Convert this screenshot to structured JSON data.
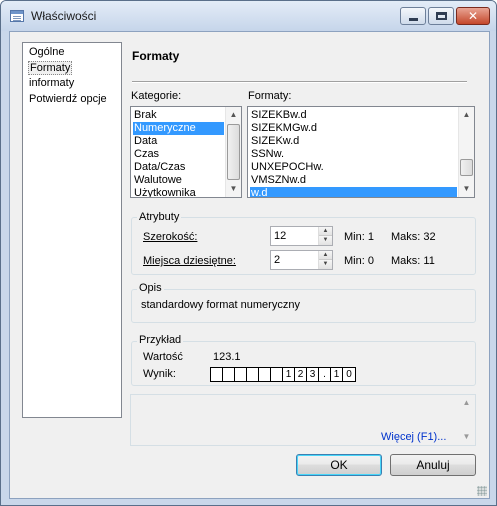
{
  "window": {
    "title": "Właściwości",
    "icon": "window-properties-icon",
    "caption_buttons": [
      "minimize",
      "maximize",
      "close"
    ]
  },
  "nav": {
    "items": [
      {
        "label": "Ogólne",
        "selected": false
      },
      {
        "label": "Formaty",
        "selected": true
      },
      {
        "label": "informaty",
        "selected": false
      },
      {
        "label": "Potwierdź opcje",
        "selected": false
      }
    ]
  },
  "page": {
    "title": "Formaty",
    "categories_label": "Kategorie:",
    "categories": [
      "Brak",
      "Numeryczne",
      "Data",
      "Czas",
      "Data/Czas",
      "Walutowe",
      "Użytkownika"
    ],
    "categories_selected": "Numeryczne",
    "formats_label": "Formaty:",
    "formats": [
      "SIZEKBw.d",
      "SIZEKMGw.d",
      "SIZEKw.d",
      "SSNw.",
      "UNXEPOCHw.",
      "VMSZNw.d",
      "w.d"
    ],
    "formats_selected": "w.d"
  },
  "attributes": {
    "group_label": "Atrybuty",
    "width_label": "Szerokość:",
    "width_value": "12",
    "width_min": "Min: 1",
    "width_max": "Maks: 32",
    "decimals_label": "Miejsca dziesiętne:",
    "decimals_value": "2",
    "decimals_min": "Min: 0",
    "decimals_max": "Maks: 11"
  },
  "description": {
    "group_label": "Opis",
    "text": "standardowy format numeryczny"
  },
  "example": {
    "group_label": "Przykład",
    "value_label": "Wartość",
    "value": "123.1",
    "result_label": "Wynik:",
    "result_cells": [
      "",
      "",
      "",
      "",
      "",
      "",
      "1",
      "2",
      "3",
      ".",
      "1",
      "0"
    ]
  },
  "more_link": "Więcej (F1)...",
  "buttons": {
    "ok": "OK",
    "cancel": "Anuluj"
  },
  "colors": {
    "selection": "#3399ff",
    "link": "#0033cc",
    "dialog_bg": "#f0f0f0"
  }
}
